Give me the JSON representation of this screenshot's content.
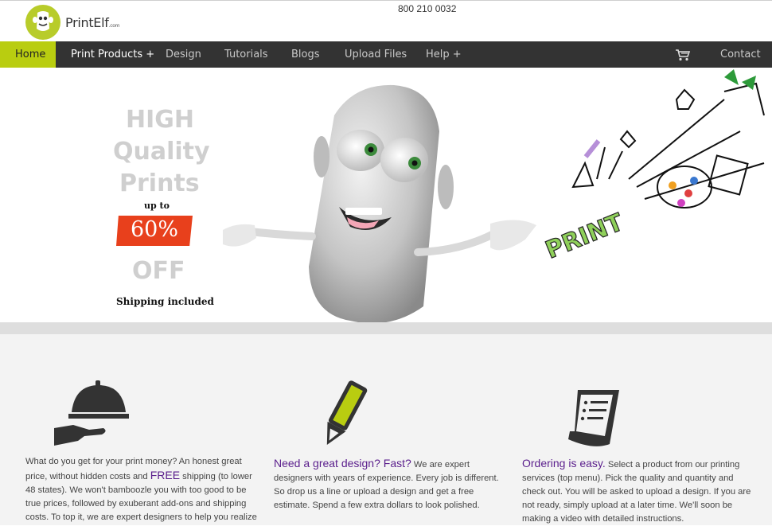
{
  "brand": {
    "name": "PrintElf",
    "suffix": ".com"
  },
  "phone": "800 210 0032",
  "nav": {
    "items": [
      {
        "label": "Home"
      },
      {
        "label": "Print Products +"
      },
      {
        "label": "Design"
      },
      {
        "label": "Tutorials"
      },
      {
        "label": "Blogs"
      },
      {
        "label": "Upload Files"
      },
      {
        "label": "Help +"
      },
      {
        "label": "Contact +"
      }
    ],
    "accent": "#b9cd10",
    "background": "#333333"
  },
  "hero": {
    "line1": "HIGH",
    "line2": "Quality",
    "line3": "Prints",
    "upto": "up to",
    "percent": "60%",
    "off": "OFF",
    "shipping": "Shipping included",
    "print_word": "PRINT",
    "badge_color": "#e8401c"
  },
  "features": [
    {
      "icon": "serving-tray-icon",
      "text_a": "What do you get for your print money? An honest great price, without hidden costs and ",
      "highlight": "FREE",
      "text_b": " shipping (to lower 48 states). We won't bamboozle you with too good to be true prices, followed by exuberant add-ons and shipping costs. To top it, we are expert designers to help you realize"
    },
    {
      "icon": "pencil-icon",
      "title": "Need a great design? Fast?",
      "text": " We are expert designers with years of experience. Every job is different. So drop us a line or upload a design and get a free estimate. Spend a few extra dollars to look polished."
    },
    {
      "icon": "receipt-icon",
      "title": "Ordering is easy.",
      "text": " Select a product from our printing services (top menu). Pick the quality and quantity and check out. You will be asked to upload a design. If you are not ready, simply upload at a later time. We'll soon be making a video with detailed instructions."
    }
  ]
}
